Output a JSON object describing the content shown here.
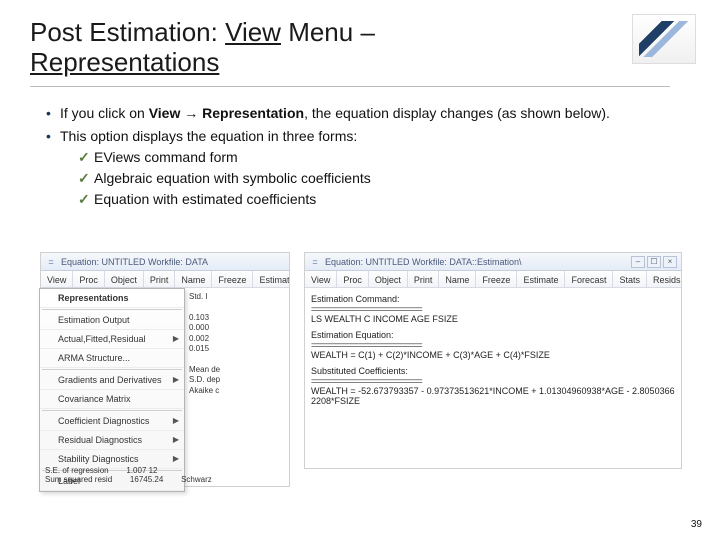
{
  "page_number": "39",
  "heading": {
    "line1_pre": "Post Estimation: ",
    "line1_u1": "View",
    "line1_mid": " Menu – ",
    "line2_u": "Representations"
  },
  "bullets": {
    "b1_pre": "If you click on ",
    "b1_bold1": "View",
    "b1_arrow": " → ",
    "b1_bold2": "Representation",
    "b1_post": ", the equation display changes (as shown below).",
    "b2": "This option displays the equation in three forms:",
    "s1": "EViews command form",
    "s2": "Algebraic equation with symbolic coefficients",
    "s3": "Equation with estimated coefficients"
  },
  "left": {
    "title_icon": "=",
    "title": "Equation: UNTITLED   Workfile: DATA",
    "toolbar": [
      "View",
      "Proc",
      "Object",
      "Print",
      "Name",
      "Freeze",
      "Estimat"
    ],
    "menu": {
      "header": "Representations",
      "items": [
        {
          "label": "Estimation Output",
          "sub": false
        },
        {
          "label": "Actual,Fitted,Residual",
          "sub": true
        },
        {
          "label": "ARMA Structure...",
          "sub": false
        },
        {
          "label": "Gradients and Derivatives",
          "sub": true
        },
        {
          "label": "Covariance Matrix",
          "sub": false
        },
        {
          "label": "Coefficient Diagnostics",
          "sub": true
        },
        {
          "label": "Residual Diagnostics",
          "sub": true
        },
        {
          "label": "Stability Diagnostics",
          "sub": true
        },
        {
          "label": "Label",
          "sub": false
        }
      ]
    },
    "side_values": "Std. I\n\n0.103\n0.000\n0.002\n0.015\n\nMean de\nS.D. dep\nAkaike c",
    "bottom": "S.E. of regression        1.007 12        \nSum squared resid        16745.24        Schwarz"
  },
  "right": {
    "title_icon": "=",
    "title": "Equation: UNTITLED   Workfile: DATA::Estimation\\",
    "toolbar": [
      "View",
      "Proc",
      "Object",
      "Print",
      "Name",
      "Freeze",
      "Estimate",
      "Forecast",
      "Stats",
      "Resids"
    ],
    "sec1_h": "Estimation Command:",
    "dash": "==========================",
    "sec1_l": "LS WEALTH C INCOME AGE FSIZE",
    "sec2_h": "Estimation Equation:",
    "sec2_l": "WEALTH = C(1) + C(2)*INCOME + C(3)*AGE + C(4)*FSIZE",
    "sec3_h": "Substituted Coefficients:",
    "sec3_l": "WEALTH = -52.673793357 - 0.97373513621*INCOME + 1.01304960938*AGE - 2.80503662208*FSIZE"
  }
}
